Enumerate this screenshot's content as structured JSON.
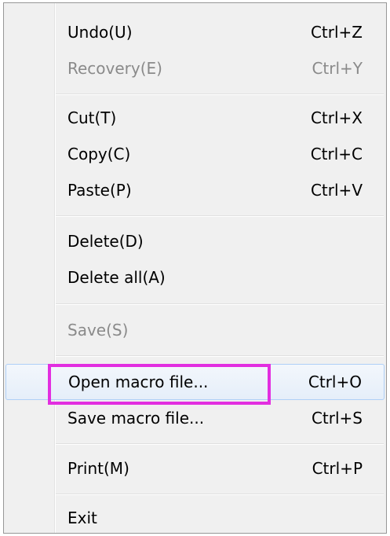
{
  "menu": {
    "items": [
      {
        "label": "Undo(U)",
        "shortcut": "Ctrl+Z"
      },
      {
        "label": "Recovery(E)",
        "shortcut": "Ctrl+Y"
      },
      {
        "label": "Cut(T)",
        "shortcut": "Ctrl+X"
      },
      {
        "label": "Copy(C)",
        "shortcut": "Ctrl+C"
      },
      {
        "label": "Paste(P)",
        "shortcut": "Ctrl+V"
      },
      {
        "label": "Delete(D)",
        "shortcut": ""
      },
      {
        "label": "Delete all(A)",
        "shortcut": ""
      },
      {
        "label": "Save(S)",
        "shortcut": ""
      },
      {
        "label": "Open macro file...",
        "shortcut": "Ctrl+O"
      },
      {
        "label": "Save macro file...",
        "shortcut": "Ctrl+S"
      },
      {
        "label": "Print(M)",
        "shortcut": "Ctrl+P"
      },
      {
        "label": "Exit",
        "shortcut": ""
      }
    ],
    "disabled_items": [
      "Recovery(E)",
      "Save(S)"
    ],
    "hovered_item": "Open macro file...",
    "colors": {
      "highlight_border": "#e22ee0",
      "hover_border": "#aecff7",
      "disabled_text": "#8a8a8a"
    }
  }
}
